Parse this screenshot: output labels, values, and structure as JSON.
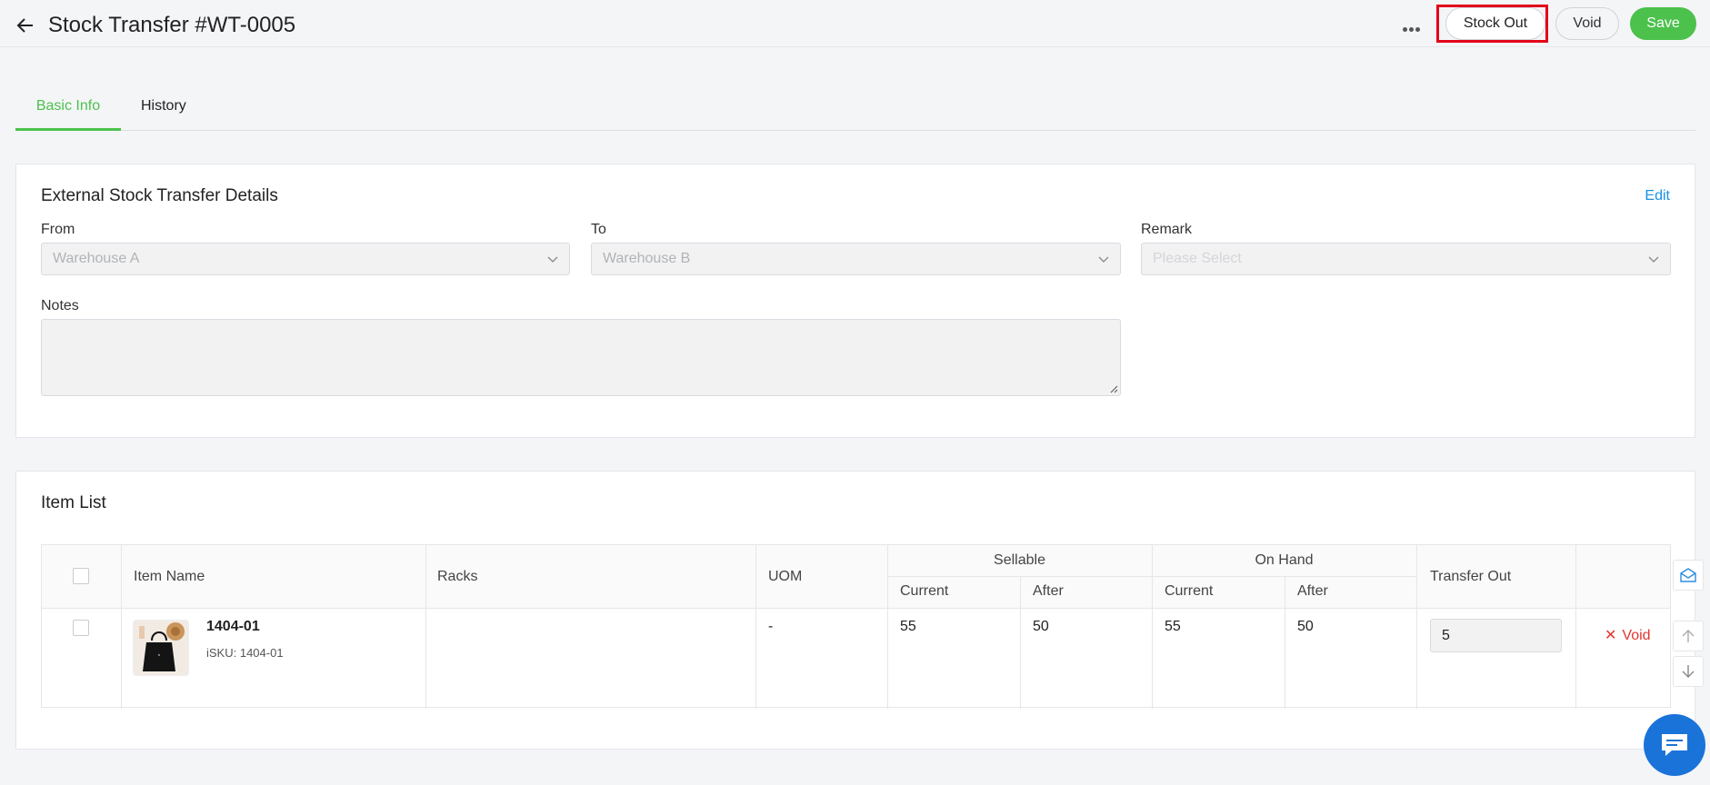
{
  "header": {
    "title": "Stock Transfer #WT-0005",
    "stock_out_label": "Stock Out",
    "void_label": "Void",
    "save_label": "Save"
  },
  "tabs": [
    {
      "label": "Basic Info",
      "active": true
    },
    {
      "label": "History",
      "active": false
    }
  ],
  "details": {
    "title": "External Stock Transfer Details",
    "edit_label": "Edit",
    "from_label": "From",
    "from_value": "Warehouse A",
    "to_label": "To",
    "to_value": "Warehouse B",
    "remark_label": "Remark",
    "remark_placeholder": "Please Select",
    "notes_label": "Notes"
  },
  "items": {
    "title": "Item List",
    "columns": {
      "item_name": "Item Name",
      "racks": "Racks",
      "uom": "UOM",
      "sellable": "Sellable",
      "on_hand": "On Hand",
      "current": "Current",
      "after": "After",
      "transfer_out": "Transfer Out"
    },
    "rows": [
      {
        "name": "1404-01",
        "isku": "iSKU: 1404-01",
        "racks": "",
        "uom": "-",
        "sellable_current": "55",
        "sellable_after": "50",
        "onhand_current": "55",
        "onhand_after": "50",
        "transfer_out": "5",
        "void_label": "Void"
      }
    ]
  },
  "colors": {
    "accent": "#4cc14c",
    "link": "#1a8fe3",
    "danger": "#e3342f",
    "highlight": "#e3001b"
  }
}
